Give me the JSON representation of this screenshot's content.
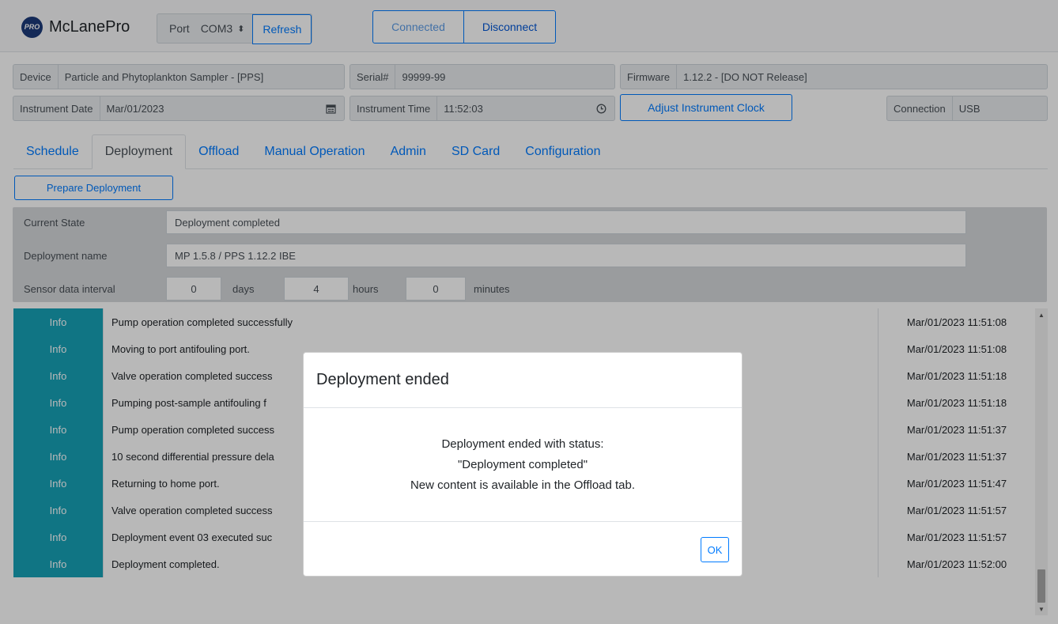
{
  "navbar": {
    "brand_logo": "PRO",
    "brand_name": "McLanePro",
    "port_label": "Port",
    "port_value": "COM3",
    "refresh_label": "Refresh",
    "connected_label": "Connected",
    "disconnect_label": "Disconnect"
  },
  "device_info": {
    "device_label": "Device",
    "device_value": "Particle and Phytoplankton Sampler - [PPS]",
    "serial_label": "Serial#",
    "serial_value": "99999-99",
    "firmware_label": "Firmware",
    "firmware_value": "1.12.2 - [DO NOT Release]",
    "date_label": "Instrument Date",
    "date_value": "Mar/01/2023",
    "time_label": "Instrument Time",
    "time_value": "11:52:03",
    "adjust_label": "Adjust Instrument Clock",
    "connection_label": "Connection",
    "connection_value": "USB"
  },
  "tabs": [
    "Schedule",
    "Deployment",
    "Offload",
    "Manual Operation",
    "Admin",
    "SD Card",
    "Configuration"
  ],
  "active_tab": "Deployment",
  "prepare_label": "Prepare Deployment",
  "state": {
    "current_state_label": "Current State",
    "current_state_value": "Deployment completed",
    "name_label": "Deployment name",
    "name_value": "MP 1.5.8 / PPS 1.12.2 IBE",
    "interval_label": "Sensor data interval",
    "days_value": "0",
    "days_label": "days",
    "hours_value": "4",
    "hours_label": "hours",
    "minutes_value": "0",
    "minutes_label": "minutes"
  },
  "log": [
    {
      "level": "Info",
      "message": "Pump operation completed successfully",
      "time": "Mar/01/2023 11:51:08"
    },
    {
      "level": "Info",
      "message": "Moving to port antifouling port.",
      "time": "Mar/01/2023 11:51:08"
    },
    {
      "level": "Info",
      "message": "Valve operation completed success",
      "time": "Mar/01/2023 11:51:18"
    },
    {
      "level": "Info",
      "message": "Pumping post-sample antifouling f",
      "time": "Mar/01/2023 11:51:18"
    },
    {
      "level": "Info",
      "message": "Pump operation completed success",
      "time": "Mar/01/2023 11:51:37"
    },
    {
      "level": "Info",
      "message": "10 second differential pressure dela",
      "time": "Mar/01/2023 11:51:37"
    },
    {
      "level": "Info",
      "message": "Returning to home port.",
      "time": "Mar/01/2023 11:51:47"
    },
    {
      "level": "Info",
      "message": "Valve operation completed success",
      "time": "Mar/01/2023 11:51:57"
    },
    {
      "level": "Info",
      "message": "Deployment event 03 executed suc",
      "time": "Mar/01/2023 11:51:57"
    },
    {
      "level": "Info",
      "message": "Deployment completed.",
      "time": "Mar/01/2023 11:52:00"
    }
  ],
  "modal": {
    "title": "Deployment ended",
    "line1": "Deployment ended with status:",
    "line2": "\"Deployment completed\"",
    "line3": "New content is available in the Offload tab.",
    "ok_label": "OK"
  },
  "colors": {
    "accent": "#007bff",
    "info_badge": "#17a2b8",
    "brand_logo": "#1d3b7a"
  },
  "icons": {
    "calendar": "calendar-icon",
    "clock": "clock-icon",
    "select_chevron": "select-chevron-icon"
  }
}
